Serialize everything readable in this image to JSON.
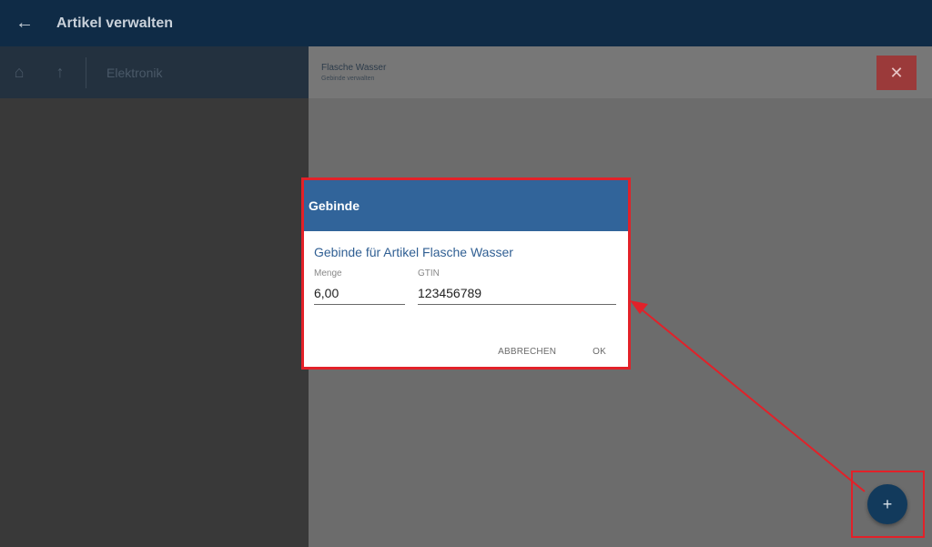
{
  "appbar": {
    "back_icon": "arrow-left-icon",
    "title": "Artikel verwalten"
  },
  "left": {
    "home_icon": "home-icon",
    "up_icon": "arrow-up-icon",
    "breadcrumb": "Elektronik"
  },
  "right": {
    "header_title": "Flasche Wasser",
    "header_subtitle": "Gebinde verwalten",
    "close_icon": "close-icon"
  },
  "dialog": {
    "title": "Gebinde",
    "subtitle": "Gebinde für Artikel Flasche Wasser",
    "menge_label": "Menge",
    "menge_value": "6,00",
    "gtin_label": "GTIN",
    "gtin_value": "123456789",
    "cancel_label": "ABBRECHEN",
    "ok_label": "OK"
  },
  "fab": {
    "icon": "plus-icon",
    "symbol": "+"
  },
  "colors": {
    "appbar": "#0f2b46",
    "dialog_header": "#31649a",
    "highlight": "#e22129",
    "close_button": "#9b3a3a",
    "fab": "#123a5c"
  }
}
